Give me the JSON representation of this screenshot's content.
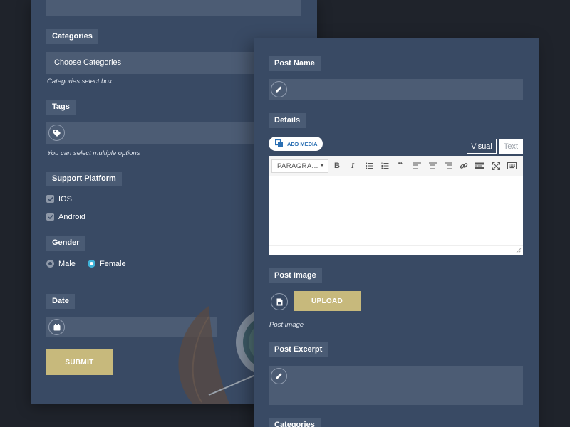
{
  "left_form": {
    "categories_label": "Categories",
    "categories_value": "Choose Categories",
    "categories_help": "Categories select box",
    "tags_label": "Tags",
    "tags_help": "You can select multiple options",
    "support_label": "Support Platform",
    "support_options": [
      {
        "label": "IOS",
        "checked": true
      },
      {
        "label": "Android",
        "checked": true
      }
    ],
    "gender_label": "Gender",
    "gender_options": [
      {
        "label": "Male",
        "selected": false
      },
      {
        "label": "Female",
        "selected": true
      }
    ],
    "date_label": "Date",
    "submit_label": "SUBMIT"
  },
  "right_form": {
    "post_name_label": "Post Name",
    "details_label": "Details",
    "add_media_label": "ADD MEDIA",
    "tab_visual": "Visual",
    "tab_text": "Text",
    "format_select": "PARAGRA...",
    "post_image_label": "Post Image",
    "upload_label": "UPLOAD",
    "post_image_help": "Post Image",
    "post_excerpt_label": "Post Excerpt",
    "categories_label": "Categories"
  },
  "colors": {
    "background": "#1f232b",
    "panel": "#394a64",
    "field": "#4c5c74",
    "accent_gold": "#c7b97c",
    "radio_selected": "#3fb3d9"
  }
}
